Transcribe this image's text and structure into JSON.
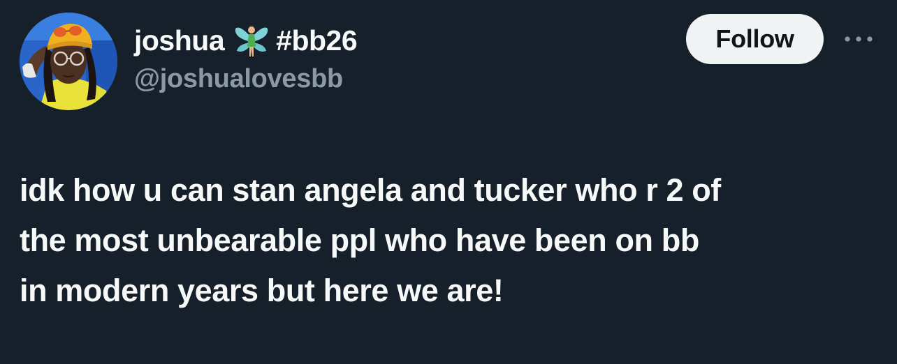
{
  "user": {
    "display_name": "joshua",
    "emoji_icon": "fairy-icon",
    "hashtag": "#bb26",
    "handle": "@joshualovesbb",
    "avatar": "avatar-photo"
  },
  "actions": {
    "follow_label": "Follow",
    "more_icon": "more-icon"
  },
  "tweet": {
    "text": "idk how u can stan angela and tucker who r 2 of\nthe most unbearable ppl who have been on bb\nin modern years but here we are!"
  },
  "colors": {
    "background": "#15202b",
    "text_primary": "#f7f9f9",
    "text_secondary": "#8b98a5",
    "follow_bg": "#eff3f4",
    "follow_text": "#0f1419"
  }
}
